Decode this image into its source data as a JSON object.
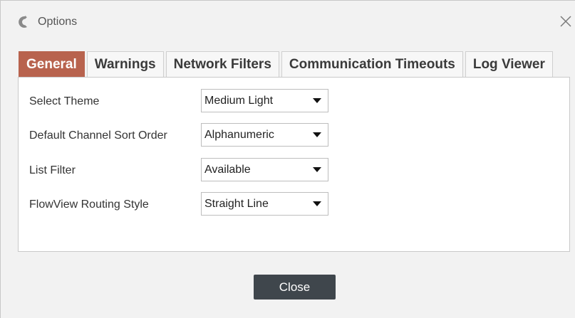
{
  "window": {
    "title": "Options",
    "close_icon": "close-icon",
    "app_icon": "app-logo-icon"
  },
  "tabs": [
    {
      "label": "General",
      "active": true
    },
    {
      "label": "Warnings",
      "active": false
    },
    {
      "label": "Network Filters",
      "active": false
    },
    {
      "label": "Communication Timeouts",
      "active": false
    },
    {
      "label": "Log Viewer",
      "active": false
    }
  ],
  "settings": [
    {
      "label": "Select Theme",
      "value": "Medium Light"
    },
    {
      "label": "Default Channel Sort Order",
      "value": "Alphanumeric"
    },
    {
      "label": "List Filter",
      "value": "Available"
    },
    {
      "label": "FlowView Routing Style",
      "value": "Straight Line"
    }
  ],
  "footer": {
    "close_label": "Close"
  },
  "colors": {
    "active_tab": "#b8634e",
    "button": "#3f464c"
  }
}
